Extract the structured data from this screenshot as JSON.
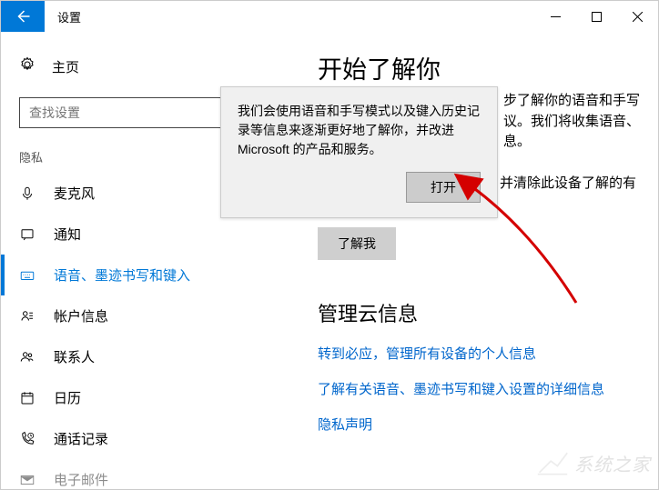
{
  "titlebar": {
    "title": "设置"
  },
  "sidebar": {
    "home": "主页",
    "search_placeholder": "查找设置",
    "group": "隐私",
    "items": [
      {
        "label": "麦克风"
      },
      {
        "label": "通知"
      },
      {
        "label": "语音、墨迹书写和键入"
      },
      {
        "label": "帐户信息"
      },
      {
        "label": "联系人"
      },
      {
        "label": "日历"
      },
      {
        "label": "通话记录"
      },
      {
        "label": "电子邮件"
      }
    ]
  },
  "main": {
    "heading1": "开始了解你",
    "partial1a": "步了解你的语音和手写",
    "partial1b": "议。我们将收集语音、",
    "partial1c": "息。",
    "partial2": "并清除此设备了解的有",
    "know_me_btn": "了解我",
    "heading2": "管理云信息",
    "link1": "转到必应，管理所有设备的个人信息",
    "link2": "了解有关语音、墨迹书写和键入设置的详细信息",
    "link3": "隐私声明"
  },
  "popup": {
    "text": "我们会使用语音和手写模式以及键入历史记录等信息来逐渐更好地了解你，并改进 Microsoft 的产品和服务。",
    "open_btn": "打开"
  },
  "watermark": "系统之家"
}
